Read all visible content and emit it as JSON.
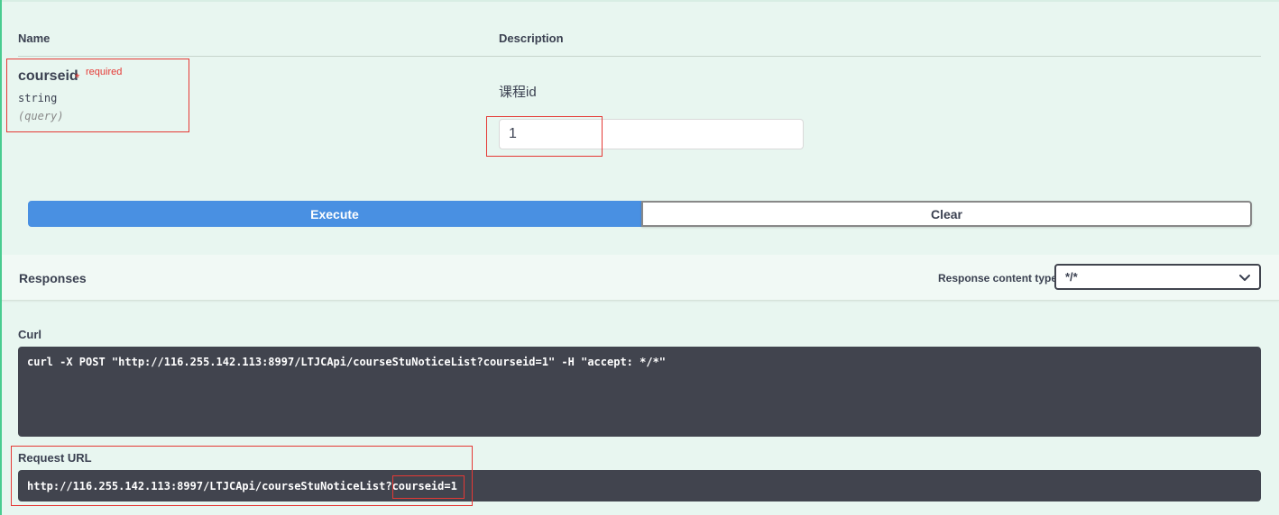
{
  "parameters": {
    "header_name": "Name",
    "header_description": "Description",
    "param": {
      "name": "courseid",
      "required_star": "*",
      "required_label": "required",
      "type": "string",
      "location": "(query)",
      "description": "课程id",
      "value": "1"
    }
  },
  "actions": {
    "execute_label": "Execute",
    "clear_label": "Clear"
  },
  "responses": {
    "title": "Responses",
    "content_type_label": "Response content type",
    "content_type_value": "*/*"
  },
  "curl": {
    "label": "Curl",
    "command": "curl -X POST \"http://116.255.142.113:8997/LTJCApi/courseStuNoticeList?courseid=1\" -H \"accept: */*\""
  },
  "request_url": {
    "label": "Request URL",
    "url": "http://116.255.142.113:8997/LTJCApi/courseStuNoticeList?courseid=1"
  },
  "colors": {
    "execute_blue": "#4990e2",
    "post_green": "#49cc90",
    "panel_bg": "#e8f6f0",
    "code_bg": "#41444e",
    "annotation_red": "#e53935"
  }
}
